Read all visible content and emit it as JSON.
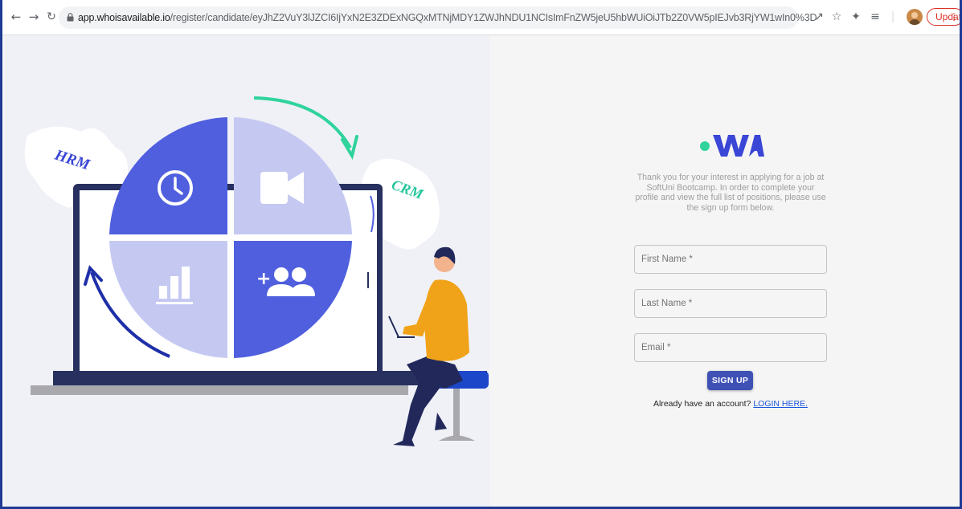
{
  "browser": {
    "url_host": "app.whoisavailable.io",
    "url_path": "/register/candidate/eyJhZ2VuY3lJZCI6IjYxN2E3ZDExNGQxMTNjMDY1ZWJhNDU1NCIsImFnZW5jeU5hbWUiOiJTb2Z0VW5pIEJvb3RjYW1wIn0%3D",
    "update_label": "Update",
    "accent_update": "#d93025",
    "icons": [
      "back-icon",
      "forward-icon",
      "reload-icon",
      "lock-icon",
      "share-icon",
      "star-icon",
      "extensions-icon",
      "reading-list-icon",
      "profile-avatar"
    ]
  },
  "illustration": {
    "puzzle_left": "HRM",
    "puzzle_right": "CRM",
    "accent_blue": "#4f5fde",
    "light_blue": "#c5c9f2",
    "arrow_green": "#2fd39b",
    "arrow_navy": "#1e2fa8"
  },
  "brand": {
    "logo_text": "WA",
    "dot_color": "#2fd39b",
    "text_color": "#3a46d6"
  },
  "form": {
    "intro": "Thank you for your interest in applying for a job at SoftUni Bootcamp. In order to complete your profile and view the full list of positions, please use the sign up form below.",
    "first_name_placeholder": "First Name *",
    "last_name_placeholder": "Last Name *",
    "email_placeholder": "Email *",
    "signup_label": "SIGN UP",
    "already_text": "Already have an account?",
    "login_link": "LOGIN HERE.",
    "button_color": "#3f51b5"
  }
}
